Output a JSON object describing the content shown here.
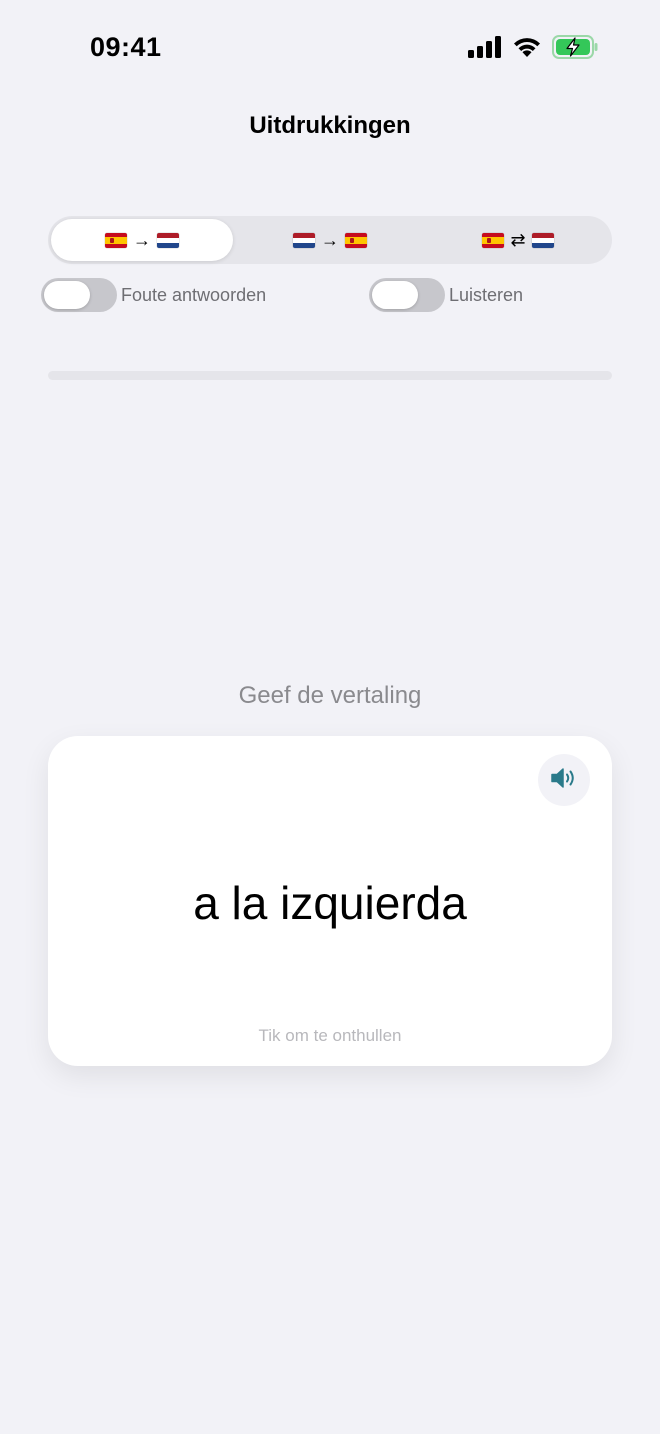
{
  "status_bar": {
    "time": "09:41",
    "icons": [
      "signal-icon",
      "wifi-icon",
      "battery-charging-icon"
    ],
    "battery_color": "#34c759"
  },
  "nav": {
    "title": "Uitdrukkingen"
  },
  "direction_selector": {
    "segments": [
      {
        "from": "spain-flag-icon",
        "arrow": "→",
        "to": "netherlands-flag-icon",
        "selected": true
      },
      {
        "from": "netherlands-flag-icon",
        "arrow": "→",
        "to": "spain-flag-icon",
        "selected": false
      },
      {
        "from": "spain-flag-icon",
        "arrow": "⇄",
        "to": "netherlands-flag-icon",
        "selected": false
      }
    ]
  },
  "toggles": {
    "wrong_answers": {
      "label": "Foute antwoorden",
      "on": false
    },
    "listen": {
      "label": "Luisteren",
      "on": false
    }
  },
  "progress": {
    "fraction": 0
  },
  "quiz": {
    "prompt": "Geef de vertaling",
    "word": "a la izquierda",
    "hint": "Tik om te onthullen",
    "speaker_icon": "speaker-icon",
    "accent_color": "#2a7a8a"
  }
}
